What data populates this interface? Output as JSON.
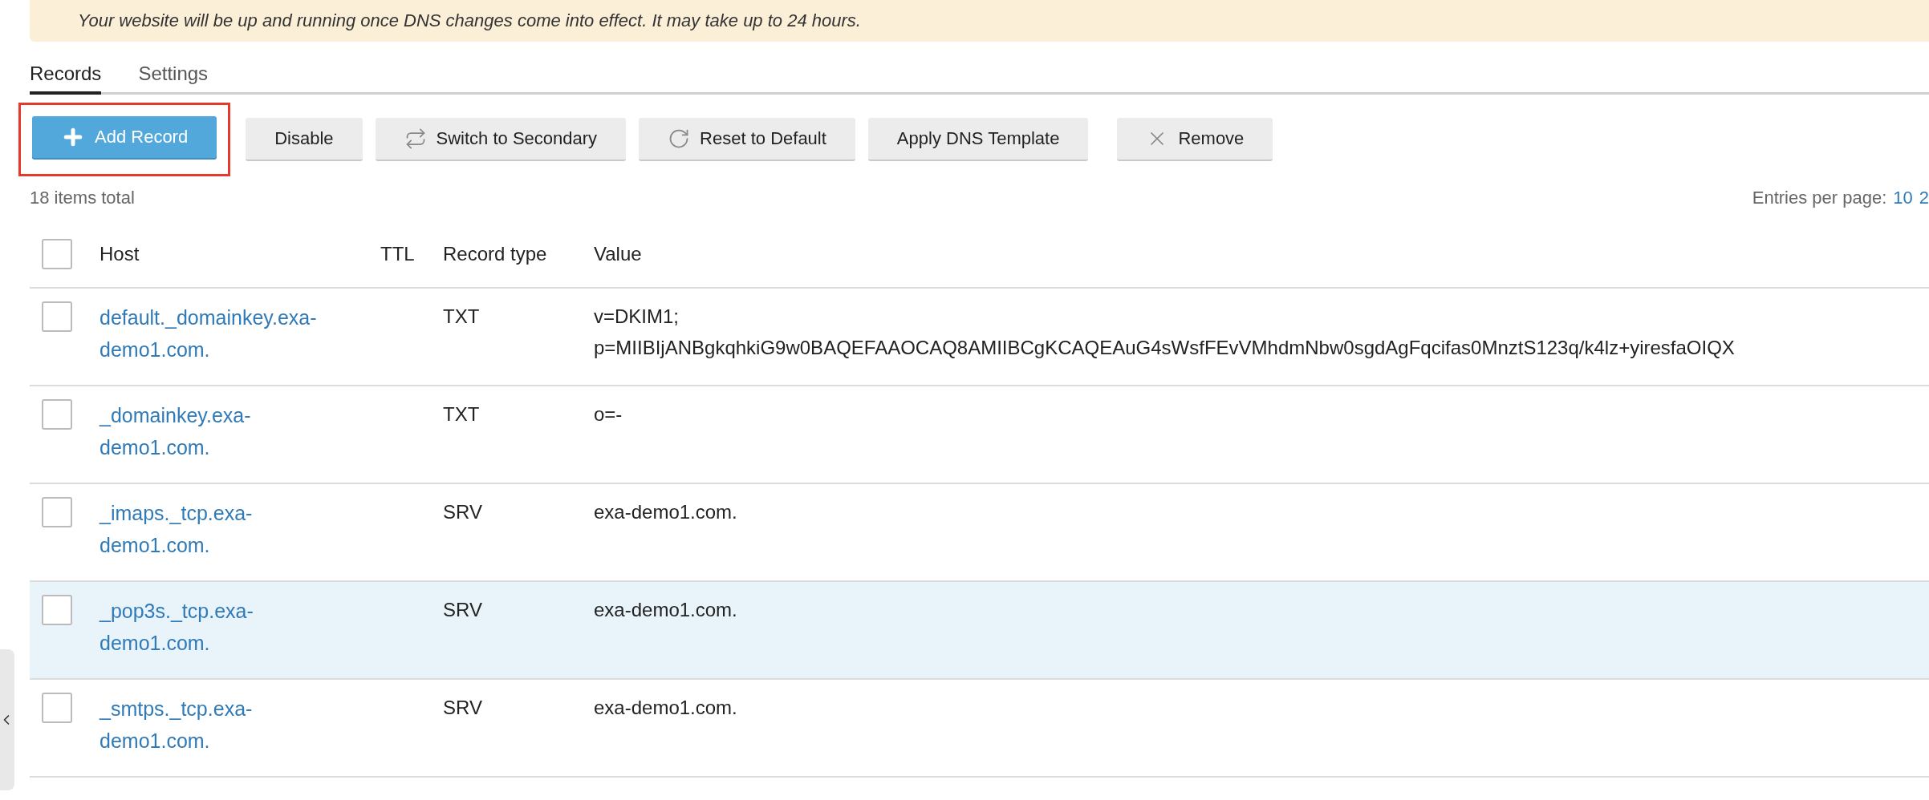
{
  "banner": {
    "text": "Your website will be up and running once DNS changes come into effect. It may take up to 24 hours."
  },
  "tabs": [
    {
      "label": "Records",
      "selected": true
    },
    {
      "label": "Settings",
      "selected": false
    }
  ],
  "toolbar": [
    {
      "label": "Add Record",
      "kind": "primary",
      "highlighted": true
    },
    {
      "label": "Disable",
      "kind": "plain",
      "highlighted": false
    },
    {
      "label": "Switch to Secondary",
      "kind": "plain",
      "highlighted": false
    },
    {
      "label": "Reset to Default",
      "kind": "plain",
      "highlighted": false
    },
    {
      "label": "Apply DNS Template",
      "kind": "plain",
      "highlighted": false
    },
    {
      "label": "Remove",
      "kind": "plain",
      "highlighted": false
    }
  ],
  "summary": {
    "total": "18 items total",
    "entries_label": "Entries per page:",
    "page_sizes": [
      {
        "label": "10"
      },
      {
        "label": "2"
      }
    ]
  },
  "table": {
    "select_all": {
      "checked": false
    },
    "columns": [
      "Host",
      "TTL",
      "Record type",
      "Value"
    ],
    "rows": [
      {
        "checked": false,
        "hovered": false,
        "host": "default._domainkey.exa-demo1.com.",
        "type": "TXT",
        "value": [
          "v=DKIM1;",
          "p=MIIBIjANBgkqhkiG9w0BAQEFAAOCAQ8AMIIBCgKCAQEAuG4sWsfFEvVMhdmNbw0sgdAgFqcifas0MnztS123q/k4lz+yiresfaOIQX"
        ]
      },
      {
        "checked": false,
        "hovered": false,
        "host": "_domainkey.exa-demo1.com.",
        "type": "TXT",
        "value": [
          "o=-"
        ]
      },
      {
        "checked": false,
        "hovered": false,
        "host": "_imaps._tcp.exa-demo1.com.",
        "type": "SRV",
        "value": [
          "exa-demo1.com."
        ]
      },
      {
        "checked": false,
        "hovered": true,
        "host": "_pop3s._tcp.exa-demo1.com.",
        "type": "SRV",
        "value": [
          "exa-demo1.com."
        ]
      },
      {
        "checked": false,
        "hovered": false,
        "host": "_smtps._tcp.exa-demo1.com.",
        "type": "SRV",
        "value": [
          "exa-demo1.com."
        ]
      }
    ]
  }
}
